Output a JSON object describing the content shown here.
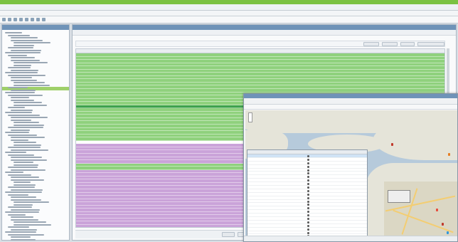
{
  "app": {
    "title": "",
    "window_title": ""
  },
  "menu": {
    "items": [
      "",
      "",
      "",
      "",
      ""
    ]
  },
  "sidebar": {
    "title": "",
    "tree_items": [
      "",
      "",
      "",
      "",
      "",
      "",
      "",
      ""
    ]
  },
  "main": {
    "tab_title": "",
    "filter_label": "",
    "filter_buttons": [
      "",
      "",
      "",
      ""
    ],
    "columns": [
      "",
      "",
      "",
      "",
      "",
      "",
      "",
      "",
      "",
      "",
      "",
      ""
    ],
    "bottom_buttons": [
      "",
      "",
      ""
    ],
    "row_state_colors": {
      "normal": "#8fd17d",
      "selected": "#3fa24e",
      "white": "#ffffff",
      "purple": "#caa3d9"
    },
    "rows": [
      "normal",
      "normal",
      "normal",
      "normal",
      "normal",
      "normal",
      "normal",
      "normal",
      "normal",
      "normal",
      "normal",
      "normal",
      "normal",
      "normal",
      "normal",
      "normal",
      "selected",
      "normal",
      "normal",
      "normal",
      "normal",
      "normal",
      "normal",
      "normal",
      "normal",
      "normal",
      "normal",
      "white",
      "purple",
      "purple",
      "purple",
      "purple",
      "purple",
      "purple",
      "normal",
      "normal",
      "purple",
      "purple",
      "purple",
      "purple",
      "purple",
      "purple",
      "purple",
      "purple",
      "purple",
      "purple",
      "purple",
      "purple",
      "purple",
      "purple",
      "purple",
      "purple",
      "purple",
      "purple",
      "purple"
    ]
  },
  "popup": {
    "title": "",
    "toolbar_label": "",
    "filter_label": "",
    "list_columns": [
      "",
      "",
      "",
      "",
      ""
    ],
    "list_rows": 26,
    "close_button": "",
    "status_text": ""
  },
  "colors": {
    "accent_green": "#7bc242",
    "header_blue": "#6f93b8",
    "water": "#b6cadb",
    "land": "#e5e4d9",
    "road": "#f3cd72"
  }
}
